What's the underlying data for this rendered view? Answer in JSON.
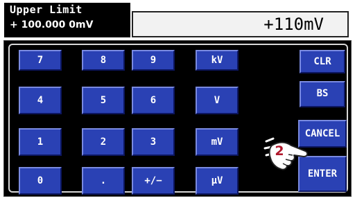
{
  "header": {
    "title": "Upper Limit",
    "current_value": "+ 100.000 0mV",
    "entry_value": "+110mV"
  },
  "keypad": {
    "digits": [
      "7",
      "8",
      "9",
      "4",
      "5",
      "6",
      "1",
      "2",
      "3",
      "0",
      ".",
      "+/−"
    ],
    "units": [
      "kV",
      "V",
      "mV",
      "µV"
    ],
    "clr": "CLR",
    "bs": "BS",
    "cancel": "CANCEL",
    "enter": "ENTER"
  },
  "annotation": {
    "step_number": "2",
    "icon": "pointing-hand-icon",
    "color": "#b0182c"
  },
  "colors": {
    "key_face": "#2a41b4",
    "panel_background": "#000000"
  }
}
